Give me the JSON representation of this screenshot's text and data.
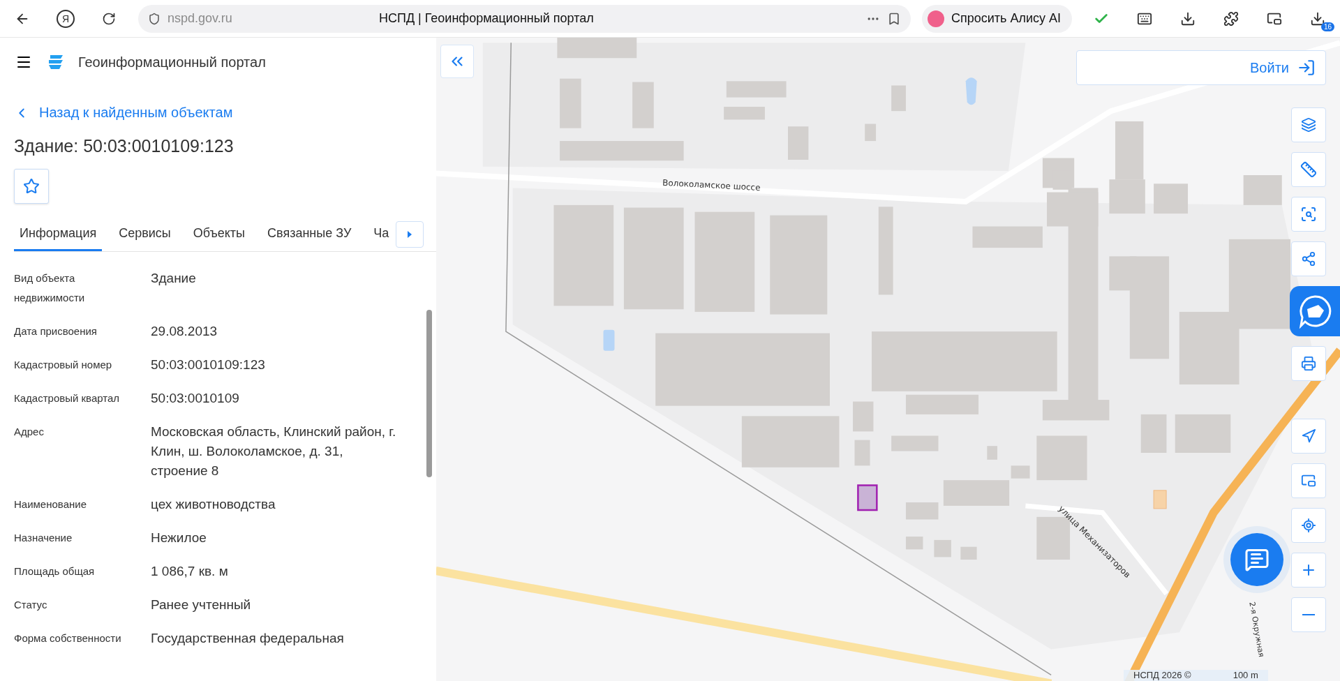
{
  "browser": {
    "url": "nspd.gov.ru",
    "title": "НСПД | Геоинформационный портал",
    "alice_button": "Спросить Алису AI",
    "extension_badge": "16",
    "yandex_logo": "Я"
  },
  "header": {
    "title": "Геоинформационный портал"
  },
  "back_link": "Назад к найденным объектам",
  "object_title": "Здание: 50:03:0010109:123",
  "favorite": {
    "selected": false
  },
  "tabs": [
    {
      "label": "Информация",
      "selected": true
    },
    {
      "label": "Сервисы",
      "selected": false
    },
    {
      "label": "Объекты",
      "selected": false
    },
    {
      "label": "Связанные ЗУ",
      "selected": false
    },
    {
      "label": "Ча",
      "selected": false
    }
  ],
  "properties": [
    {
      "label": "Вид объекта недвижимости",
      "value": "Здание"
    },
    {
      "label": "Дата присвоения",
      "value": "29.08.2013"
    },
    {
      "label": "Кадастровый номер",
      "value": "50:03:0010109:123"
    },
    {
      "label": "Кадастровый квартал",
      "value": "50:03:0010109"
    },
    {
      "label": "Адрес",
      "value": "Московская область, Клинский район, г. Клин, ш. Волоколамское, д. 31, строение 8"
    },
    {
      "label": "Наименование",
      "value": "цех животноводства"
    },
    {
      "label": "Назначение",
      "value": "Нежилое"
    },
    {
      "label": "Площадь общая",
      "value": "1 086,7 кв. м"
    },
    {
      "label": "Статус",
      "value": "Ранее учтенный"
    },
    {
      "label": "Форма собственности",
      "value": "Государственная федеральная"
    }
  ],
  "map": {
    "login_button": "Войти",
    "road_labels": [
      {
        "text": "Волоколамское шоссе",
        "kind": "highway"
      },
      {
        "text": "улица Механизаторов",
        "kind": "street"
      },
      {
        "text": "2-я Окружная",
        "kind": "side"
      }
    ],
    "attribution": "НСПД 2026 ©",
    "scale": "100 m"
  }
}
